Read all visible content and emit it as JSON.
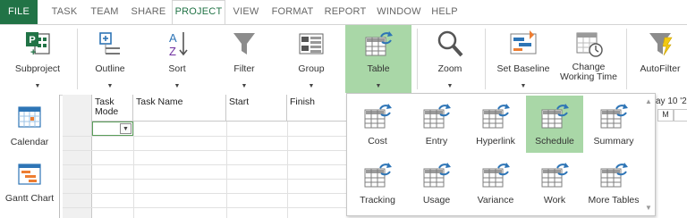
{
  "tabs": [
    {
      "label": "FILE"
    },
    {
      "label": "TASK"
    },
    {
      "label": "TEAM"
    },
    {
      "label": "SHARE"
    },
    {
      "label": "PROJECT"
    },
    {
      "label": "VIEW"
    },
    {
      "label": "FORMAT"
    },
    {
      "label": "REPORT"
    },
    {
      "label": "WINDOW"
    },
    {
      "label": "HELP"
    }
  ],
  "ribbon": {
    "subproject": {
      "label": "Subproject",
      "icon": "subproject-icon"
    },
    "outline": {
      "label": "Outline",
      "icon": "outline-icon"
    },
    "sort": {
      "label": "Sort",
      "icon": "sort-az-icon"
    },
    "filter": {
      "label": "Filter",
      "icon": "filter-funnel-icon"
    },
    "group": {
      "label": "Group",
      "icon": "group-icon"
    },
    "table": {
      "label": "Table",
      "icon": "table-icon"
    },
    "zoom": {
      "label": "Zoom",
      "icon": "magnifier-icon"
    },
    "set_baseline": {
      "label": "Set Baseline",
      "icon": "set-baseline-icon"
    },
    "change_working_time": {
      "label1": "Change",
      "label2": "Working Time",
      "icon": "calendar-clock-icon"
    },
    "autofilter": {
      "label": "AutoFilter",
      "icon": "autofilter-icon"
    },
    "dropdown_glyph": "▼"
  },
  "viewbar": {
    "calendar": {
      "label": "Calendar"
    },
    "gantt": {
      "label": "Gantt Chart"
    }
  },
  "grid": {
    "headers": {
      "task_mode_1": "Task",
      "task_mode_2": "Mode",
      "task_name": "Task Name",
      "start": "Start",
      "finish": "Finish"
    },
    "dropdown_glyph": "▼"
  },
  "timeline": {
    "date": "ay 10 '2",
    "day": "M"
  },
  "table_gallery": {
    "items": [
      {
        "label": "Cost"
      },
      {
        "label": "Entry"
      },
      {
        "label": "Hyperlink"
      },
      {
        "label": "Schedule"
      },
      {
        "label": "Summary"
      },
      {
        "label": "Tracking"
      },
      {
        "label": "Usage"
      },
      {
        "label": "Variance"
      },
      {
        "label": "Work"
      },
      {
        "label": "More Tables"
      }
    ],
    "selected": "Schedule",
    "scroll_up": "▲",
    "scroll_down": "▼"
  },
  "colors": {
    "accent": "#217346",
    "selected": "#a9d7a7",
    "icon_blue": "#2e75b6",
    "icon_gray": "#7f7f7f"
  }
}
